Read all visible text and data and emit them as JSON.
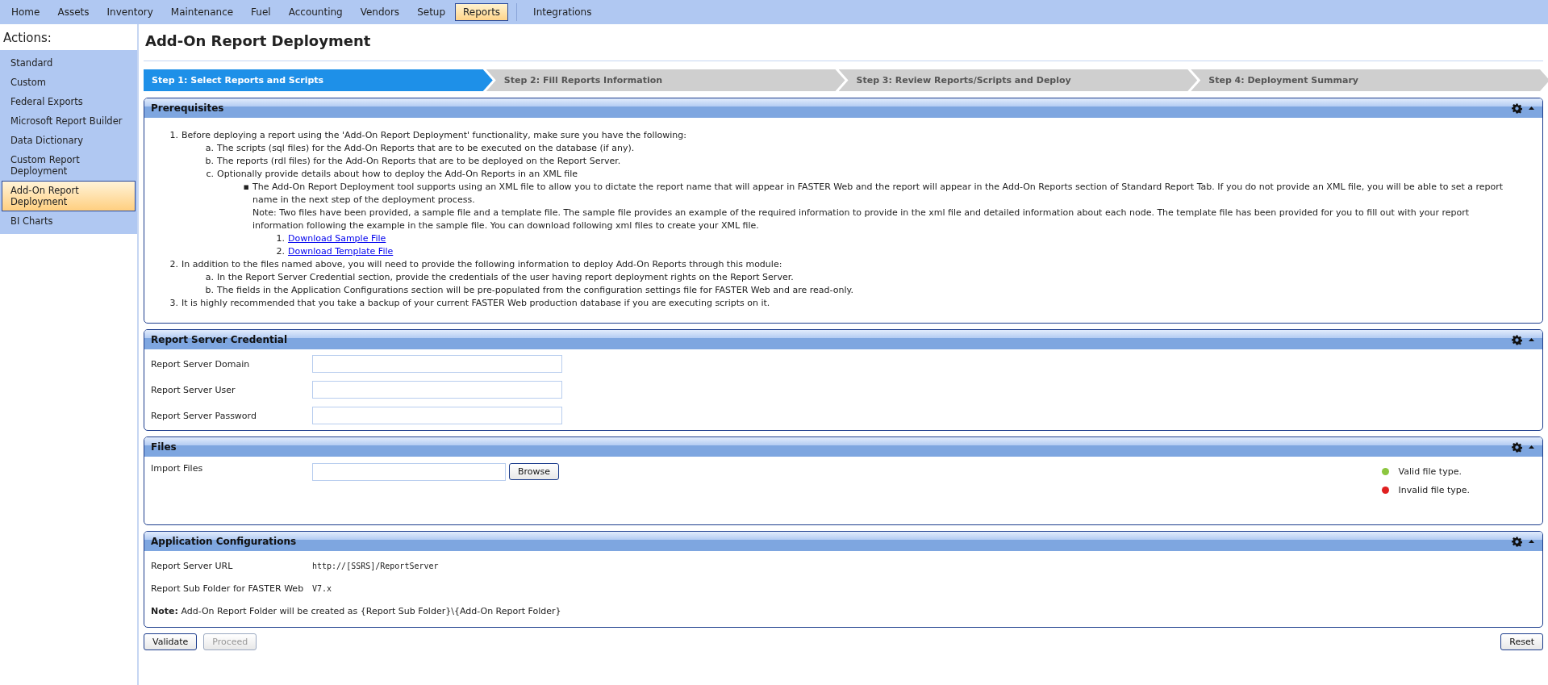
{
  "menu": [
    {
      "label": "Home",
      "selected": false
    },
    {
      "label": "Assets",
      "selected": false
    },
    {
      "label": "Inventory",
      "selected": false
    },
    {
      "label": "Maintenance",
      "selected": false
    },
    {
      "label": "Fuel",
      "selected": false
    },
    {
      "label": "Accounting",
      "selected": false
    },
    {
      "label": "Vendors",
      "selected": false
    },
    {
      "label": "Setup",
      "selected": false
    },
    {
      "label": "Reports",
      "selected": true
    },
    {
      "label": "Integrations",
      "selected": false
    }
  ],
  "sidebar": {
    "title": "Actions:",
    "items": [
      {
        "label": "Standard",
        "selected": false
      },
      {
        "label": "Custom",
        "selected": false
      },
      {
        "label": "Federal Exports",
        "selected": false
      },
      {
        "label": "Microsoft Report Builder",
        "selected": false
      },
      {
        "label": "Data Dictionary",
        "selected": false
      },
      {
        "label": "Custom Report Deployment",
        "selected": false
      },
      {
        "label": "Add-On Report Deployment",
        "selected": true
      },
      {
        "label": "BI Charts",
        "selected": false
      }
    ]
  },
  "page_title": "Add-On Report Deployment",
  "steps": [
    {
      "label": "Step 1: Select Reports and Scripts",
      "selected": true
    },
    {
      "label": "Step 2: Fill Reports Information",
      "selected": false
    },
    {
      "label": "Step 3: Review Reports/Scripts and Deploy",
      "selected": false
    },
    {
      "label": "Step 4: Deployment Summary",
      "selected": false
    }
  ],
  "prerequisites": {
    "title": "Prerequisites",
    "items": [
      {
        "marker": "1.",
        "text": "Before deploying a report using the 'Add-On Report Deployment' functionality, make sure you have the following:",
        "children": [
          {
            "marker": "a.",
            "text": "The scripts (sql files) for the Add-On Reports that are to be executed on the database (if any)."
          },
          {
            "marker": "b.",
            "text": "The reports (rdl files) for the Add-On Reports that are to be deployed on the Report Server."
          },
          {
            "marker": "c.",
            "text": "Optionally provide details about how to deploy the Add-On Reports in an XML file",
            "children": [
              {
                "marker": "▪",
                "text": "The Add-On Report Deployment tool supports using an XML file to allow you to dictate the report name that will appear in FASTER Web and the report will appear in the Add-On Reports section of Standard Report Tab. If you do not provide an XML file, you will be able to set a report name in the next step of the deployment process.",
                "note": "Note: Two files have been provided, a sample file and a template file. The sample file provides an example of the required information to provide in the xml file and detailed information about each node. The template file has been provided for you to fill out with your report information following the example in the sample file. You can download following xml files to create your XML file.",
                "links": [
                  {
                    "marker": "1.",
                    "label": "Download Sample File"
                  },
                  {
                    "marker": "2.",
                    "label": "Download Template File"
                  }
                ]
              }
            ]
          }
        ]
      },
      {
        "marker": "2.",
        "text": "In addition to the files named above, you will need to provide the following information to deploy Add-On Reports through this module:",
        "children": [
          {
            "marker": "a.",
            "text": "In the Report Server Credential section, provide the credentials of the user having report deployment rights on the Report Server."
          },
          {
            "marker": "b.",
            "text": "The fields in the Application Configurations section will be pre-populated from the configuration settings file for FASTER Web and are read-only."
          }
        ]
      },
      {
        "marker": "3.",
        "text": "It is highly recommended that you take a backup of your current FASTER Web production database if you are executing scripts on it."
      }
    ]
  },
  "credential": {
    "title": "Report Server Credential",
    "fields": [
      {
        "label": "Report Server Domain"
      },
      {
        "label": "Report Server User"
      },
      {
        "label": "Report Server Password"
      }
    ]
  },
  "files": {
    "title": "Files",
    "field_label": "Import Files",
    "browse": "Browse",
    "legend": [
      {
        "label": "Valid file type.",
        "color": "#8cc63f"
      },
      {
        "label": "Invalid file type.",
        "color": "#e02020"
      }
    ]
  },
  "app_config": {
    "title": "Application Configurations",
    "rows": [
      {
        "label": "Report Server URL",
        "value": "http://[SSRS]/ReportServer"
      },
      {
        "label": "Report Sub Folder for FASTER Web",
        "value": "V7.x"
      }
    ],
    "note": "**Note:** Add-On Report Folder will be created as {Report Sub Folder}\\{Add-On Report Folder}"
  },
  "buttons": [
    {
      "label": "Validate",
      "disabled": false
    },
    {
      "label": "Proceed",
      "disabled": true
    }
  ],
  "reset": {
    "label": "Reset",
    "disabled": false
  }
}
